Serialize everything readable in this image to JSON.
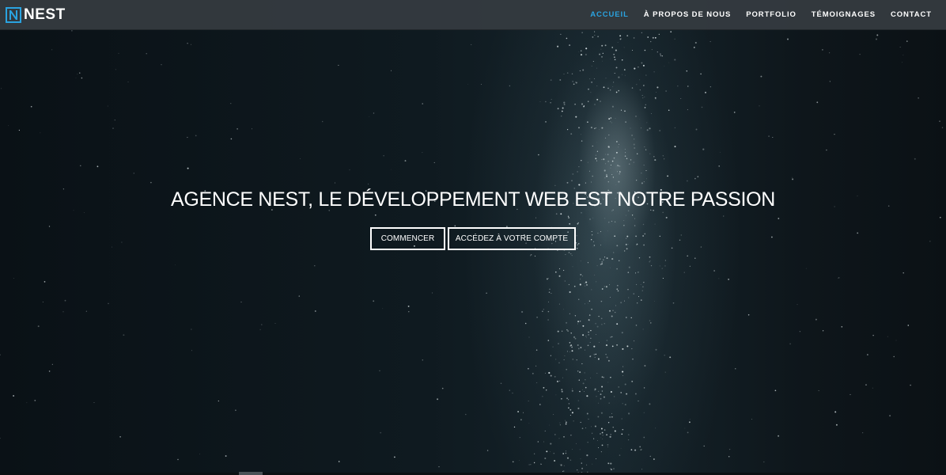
{
  "brand": {
    "logo_letter": "N",
    "name": "NEST",
    "accent_color": "#2aa3e0"
  },
  "nav": {
    "items": [
      {
        "label": "ACCUEIL",
        "active": true
      },
      {
        "label": "À PROPOS DE NOUS",
        "active": false
      },
      {
        "label": "PORTFOLIO",
        "active": false
      },
      {
        "label": "TÉMOIGNAGES",
        "active": false
      },
      {
        "label": "CONTACT",
        "active": false
      }
    ]
  },
  "hero": {
    "title": "AGENCE NEST, LE DÉVELOPPEMENT WEB EST NOTRE PASSION",
    "buttons": {
      "start_label": "COMMENCER",
      "account_label": "ACCÉDEZ À VOTRE COMPTE"
    }
  }
}
